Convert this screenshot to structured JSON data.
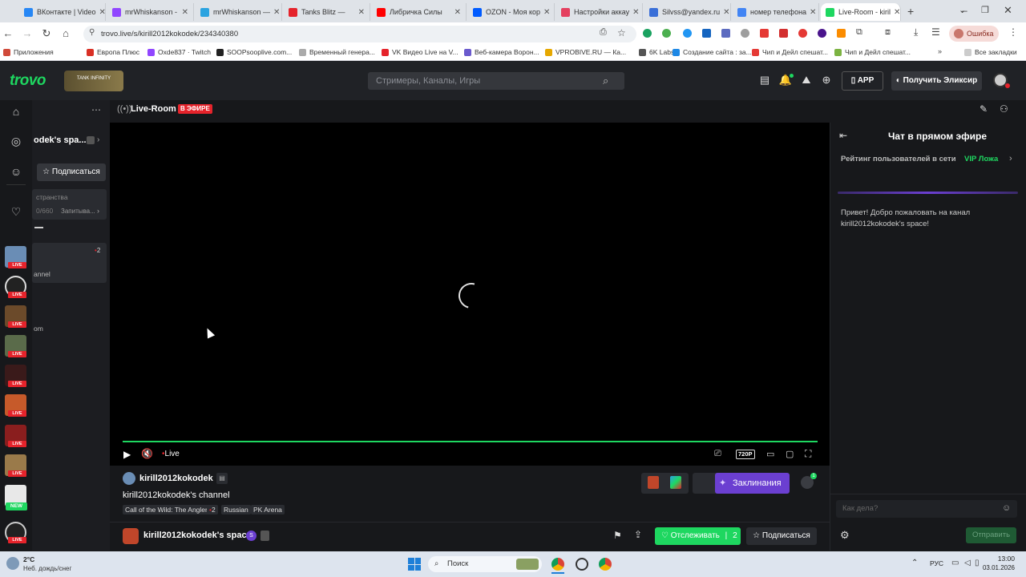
{
  "browser": {
    "tabs": [
      {
        "label": "ВКонтакте | Video",
        "color": "#2787f5",
        "active": false
      },
      {
        "label": "mrWhiskanson - ",
        "color": "#9146ff",
        "active": false
      },
      {
        "label": "mrWhiskanson — ",
        "color": "#2aa3e0",
        "active": false
      },
      {
        "label": "Tanks Blitz — ",
        "color": "#e5232b",
        "active": false
      },
      {
        "label": "Либричка Силы",
        "color": "#ff0000",
        "active": false
      },
      {
        "label": "OZON - Моя кор",
        "color": "#005bff",
        "active": false
      },
      {
        "label": "Настройки аккау",
        "color": "#e4405f",
        "active": false
      },
      {
        "label": "Silvss@yandex.ru",
        "color": "#3a6fd8",
        "active": false
      },
      {
        "label": "номер телефона",
        "color": "#4285f4",
        "active": false
      },
      {
        "label": "Live-Room - kiril",
        "color": "#1ed760",
        "active": true
      }
    ],
    "url": "trovo.live/s/kirill2012kokodek/234340380",
    "error_badge": "Ошибка",
    "bookmarks": [
      "Приложения",
      "Европа Плюс",
      "Oxde837 · Twitch",
      "SOOPsooplive.com...",
      "Временный генера...",
      "VK Видео Live на V...",
      "Веб-камера Ворон...",
      "VPROBIVE.RU — Ка...",
      "6K Labs",
      "Создание сайта : за...",
      "Чип и Дейл спешат...",
      "Чип и Дейл спешат..."
    ],
    "all_bookmarks": "Все закладки"
  },
  "header": {
    "logo": "trovo",
    "banner": "TANK INFINITY",
    "search_placeholder": "Стримеры, Каналы, Игры",
    "app_label": "APP",
    "elixir_label": "Получить Эликсир"
  },
  "sidepanel": {
    "channel_name": "odek's spa...",
    "subscribe_label": "Подписаться",
    "row1_a": "странства",
    "row1_b": "0/660",
    "row1_c": "Запитыва...",
    "count": "2",
    "item1": "annel",
    "item2": "om"
  },
  "main": {
    "room_title": "Live-Room",
    "live_badge": "В ЭФИРЕ",
    "player": {
      "live_label": "Live",
      "quality": "720P"
    },
    "streamer_name": "kirill2012kokodek",
    "channel_title": "kirill2012kokodek's channel",
    "tags": [
      "Call of the Wild: The Angler",
      "2",
      "Russian",
      "PK Arena"
    ],
    "spells_label": "Заклинания",
    "space_name": "kirill2012kokodek's space",
    "follow_label": "Отслеживать",
    "follow_count": "2",
    "subscribe_label": "Подписаться"
  },
  "chat": {
    "title": "Чат в прямом эфире",
    "rating_label": "Рейтинг пользователей в сети",
    "vip_label": "VIP Ложа",
    "welcome": "Привет! Добро пожаловать на канал kirill2012kokodek's space!",
    "input_placeholder": "Как дела?",
    "send_label": "Отправить"
  },
  "taskbar": {
    "weather_temp": "2°C",
    "weather_desc": "Неб. дождь/снег",
    "search_label": "Поиск",
    "lang": "РУС",
    "time": "13:00",
    "date": "03.01.2026"
  },
  "colors": {
    "accent": "#1ed760",
    "live_red": "#e5232b",
    "purple": "#6b3fd1"
  }
}
